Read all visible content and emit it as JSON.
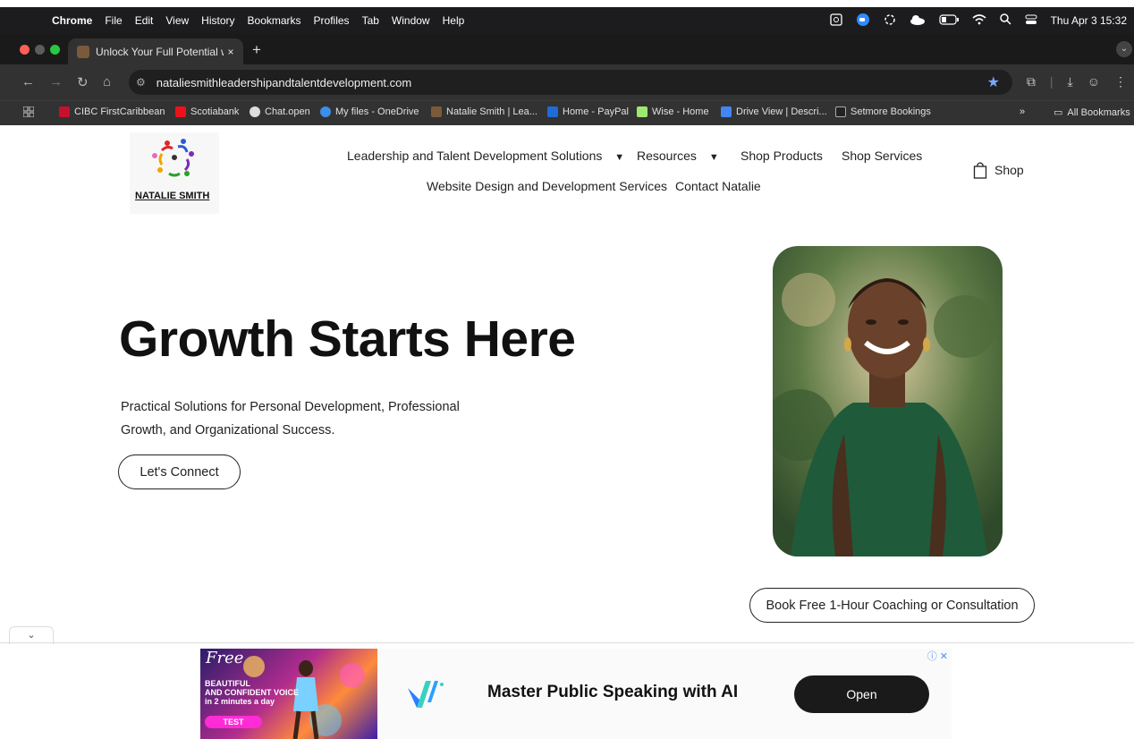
{
  "menubar": {
    "app": "Chrome",
    "items": [
      "File",
      "Edit",
      "View",
      "History",
      "Bookmarks",
      "Profiles",
      "Tab",
      "Window",
      "Help"
    ],
    "datetime": "Thu Apr 3  15:32"
  },
  "tab": {
    "title": "Unlock Your Full Potential with",
    "close": "×",
    "new": "+"
  },
  "address": {
    "url": "nataliesmithleadershipandtalentdevelopment.com"
  },
  "bookmarks": [
    {
      "label": "CIBC FirstCaribbean",
      "color": "#c8102e"
    },
    {
      "label": "Scotiabank",
      "color": "#ec111a"
    },
    {
      "label": "Chat.open",
      "color": "#dddddd"
    },
    {
      "label": "My files - OneDrive",
      "color": "#3b8fe8"
    },
    {
      "label": "Natalie Smith | Lea...",
      "color": "#7a5a3a"
    },
    {
      "label": "Home - PayPal",
      "color": "#1f6bd8"
    },
    {
      "label": "Wise - Home",
      "color": "#9fe870"
    },
    {
      "label": "Drive View | Descri...",
      "color": "#4285f4"
    },
    {
      "label": "Setmore Bookings",
      "color": "#222222"
    }
  ],
  "bookmarks_more": "»",
  "bookmarks_all": "All Bookmarks",
  "site": {
    "logo_text": "NATALIE SMITH",
    "nav": {
      "leadership": "Leadership and Talent Development Solutions",
      "resources": "Resources",
      "shop_products": "Shop Products",
      "shop_services": "Shop Services",
      "website_design": "Website Design and Development Services",
      "contact": "Contact Natalie",
      "cart": "Shop"
    },
    "hero": {
      "title": "Growth Starts Here",
      "subtitle": "Practical Solutions for Personal Development, Professional Growth, and Organizational Success.",
      "cta": "Let's Connect"
    },
    "book_button": "Book Free 1-Hour Coaching or Consultation"
  },
  "ad": {
    "image_free": "Free",
    "image_line1": "BEAUTIFUL",
    "image_line2": "AND CONFIDENT VOICE",
    "image_line3": "in 2 minutes a day",
    "image_badge": "TEST",
    "headline": "Master Public Speaking with AI",
    "button": "Open",
    "choices": "ⓘ ✕"
  }
}
